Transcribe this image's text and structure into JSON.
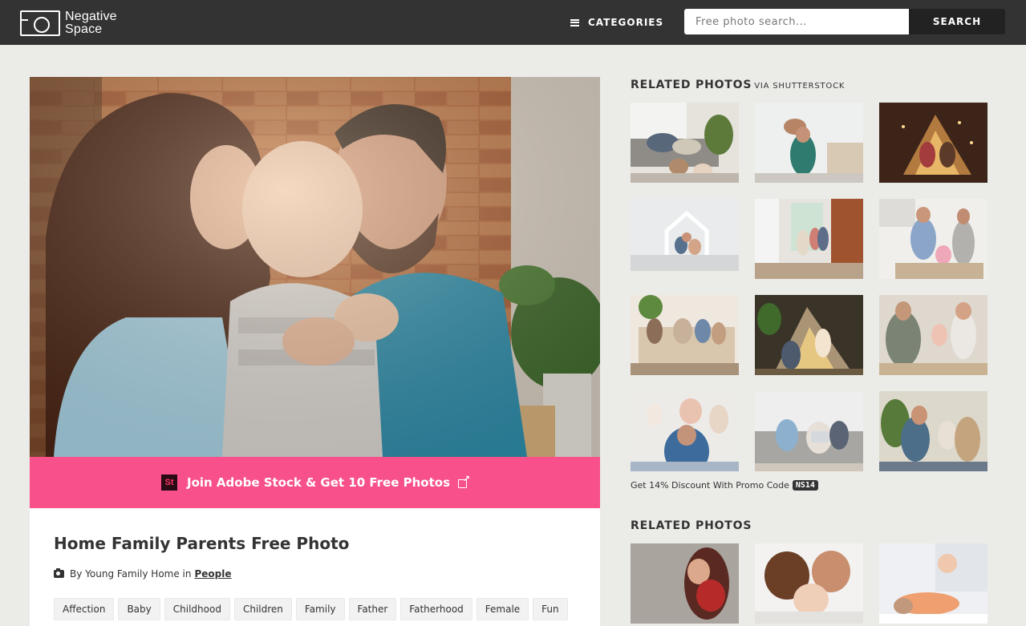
{
  "header": {
    "logo_line1": "Negative",
    "logo_line2": "Space",
    "categories_label": "CATEGORIES",
    "search_placeholder": "Free photo search...",
    "search_button": "SEARCH"
  },
  "promo": {
    "badge": "St",
    "label": "Join Adobe Stock & Get 10 Free Photos"
  },
  "photo": {
    "title": "Home Family Parents Free Photo",
    "byline_prefix": "By Young Family Home in",
    "category": "People",
    "tags": [
      "Affection",
      "Baby",
      "Childhood",
      "Children",
      "Family",
      "Father",
      "Fatherhood",
      "Female",
      "Fun"
    ]
  },
  "sidebar": {
    "related_title": "RELATED PHOTOS",
    "related_via": "VIA SHUTTERSTOCK",
    "discount_text": "Get 14% Discount With Promo Code",
    "promo_code": "NS14",
    "related_title_2": "RELATED PHOTOS"
  },
  "colors": {
    "header_bg": "#333333",
    "promo_pink": "#f7508a",
    "page_bg": "#ebebe8"
  }
}
